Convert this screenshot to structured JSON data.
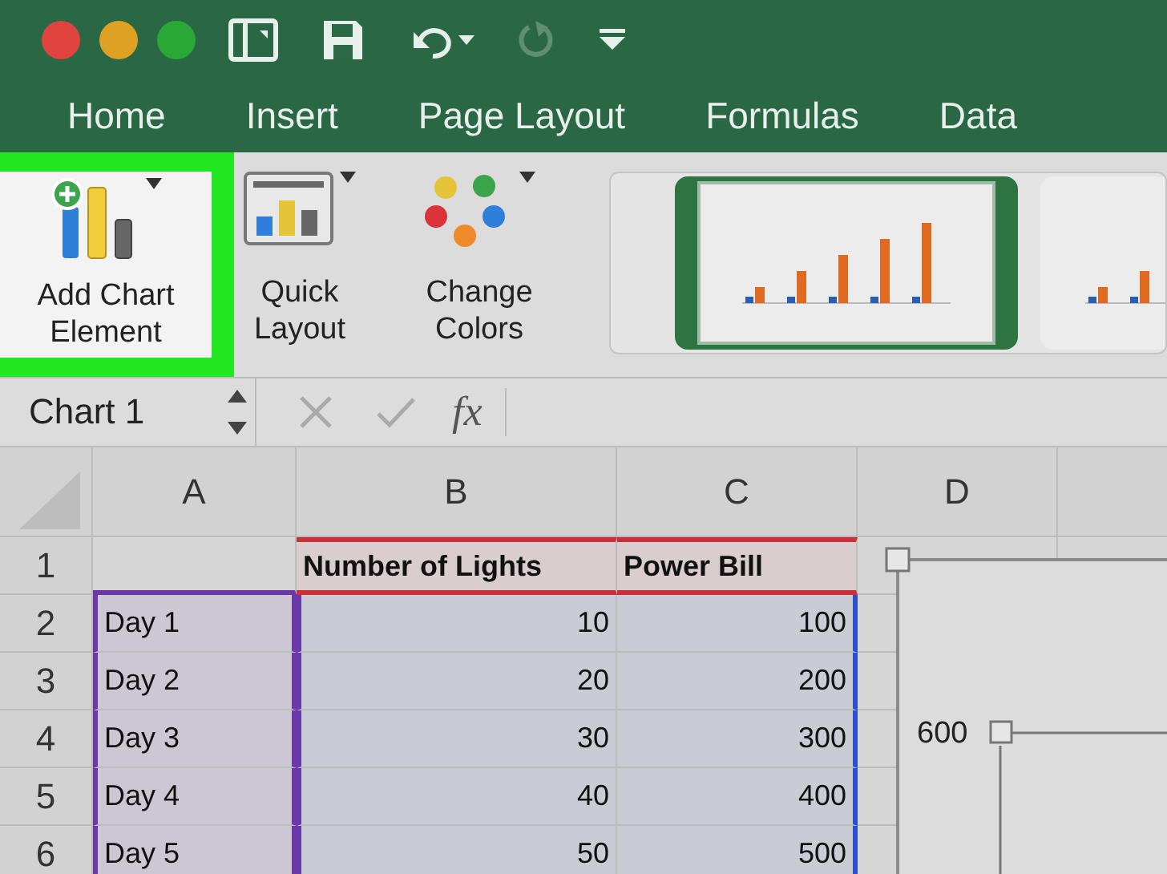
{
  "tabs": [
    {
      "label": "Home"
    },
    {
      "label": "Insert"
    },
    {
      "label": "Page Layout"
    },
    {
      "label": "Formulas"
    },
    {
      "label": "Data"
    }
  ],
  "ribbon": {
    "buttons": [
      {
        "kind": "add-element",
        "lines": [
          "Add Chart",
          "Element"
        ],
        "highlighted": true
      },
      {
        "kind": "quick-layout",
        "lines": [
          "Quick",
          "Layout"
        ],
        "highlighted": false
      },
      {
        "kind": "change-colors",
        "lines": [
          "Change",
          "Colors"
        ],
        "highlighted": false
      }
    ],
    "chart_styles": [
      {
        "selected": true
      },
      {
        "selected": false
      }
    ]
  },
  "formula_bar": {
    "name_box": "Chart 1",
    "function_symbol": "fx"
  },
  "sheet": {
    "columns": [
      "A",
      "B",
      "C",
      "D"
    ],
    "rows": [
      {
        "number": "1",
        "cells": [
          null,
          "Number of Lights",
          "Power Bill"
        ]
      },
      {
        "number": "2",
        "cells": [
          "Day 1",
          "10",
          "100"
        ]
      },
      {
        "number": "3",
        "cells": [
          "Day 2",
          "20",
          "200"
        ]
      },
      {
        "number": "4",
        "cells": [
          "Day 3",
          "30",
          "300"
        ]
      },
      {
        "number": "5",
        "cells": [
          "Day 4",
          "40",
          "400"
        ]
      },
      {
        "number": "6",
        "cells": [
          "Day 5",
          "50",
          "500"
        ]
      }
    ]
  },
  "chart": {
    "axis_label": "600"
  }
}
